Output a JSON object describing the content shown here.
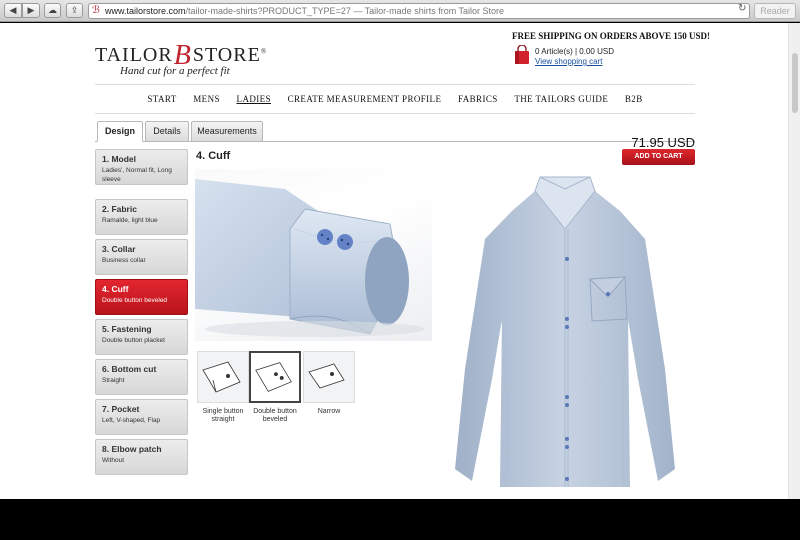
{
  "browser": {
    "url_host": "www.tailorstore.com",
    "url_rest": "/tailor-made-shirts?PRODUCT_TYPE=27 — Tailor-made shirts from Tailor Store",
    "reader": "Reader"
  },
  "header": {
    "logo_left": "TAILOR",
    "logo_mark": "B",
    "logo_right": "STORE",
    "logo_reg": "®",
    "tagline": "Hand cut for a perfect fit",
    "shipping": "FREE SHIPPING ON ORDERS ABOVE 150 USD!",
    "cart_count": "0 Article(s) | 0.00 USD",
    "cart_link": "View shopping cart"
  },
  "nav": {
    "items": [
      {
        "label": "START"
      },
      {
        "label": "MENS"
      },
      {
        "label": "LADIES"
      },
      {
        "label": "CREATE MEASUREMENT PROFILE"
      },
      {
        "label": "FABRICS"
      },
      {
        "label": "THE TAILORS GUIDE"
      },
      {
        "label": "B2B"
      }
    ],
    "active": "LADIES"
  },
  "tabs": [
    {
      "label": "Design"
    },
    {
      "label": "Details"
    },
    {
      "label": "Measurements"
    }
  ],
  "steps": [
    {
      "title": "1. Model",
      "sub": "Ladies', Normal fit, Long sleeve"
    },
    {
      "title": "2. Fabric",
      "sub": "Ramalde, light blue"
    },
    {
      "title": "3. Collar",
      "sub": "Business collar"
    },
    {
      "title": "4. Cuff",
      "sub": "Double button beveled"
    },
    {
      "title": "5. Fastening",
      "sub": "Double button placket"
    },
    {
      "title": "6. Bottom cut",
      "sub": "Straight"
    },
    {
      "title": "7. Pocket",
      "sub": "Left, V-shaped, Flap"
    },
    {
      "title": "8. Elbow patch",
      "sub": "Without"
    }
  ],
  "section_title": "4. Cuff",
  "options": [
    {
      "label": "Single button straight"
    },
    {
      "label": "Double button beveled"
    },
    {
      "label": "Narrow"
    }
  ],
  "price": "71.95 USD",
  "add_to_cart": "ADD TO CART",
  "colors": {
    "accent": "#c8161f",
    "shirt": "#b9c8dc",
    "button": "#5b77b8"
  }
}
